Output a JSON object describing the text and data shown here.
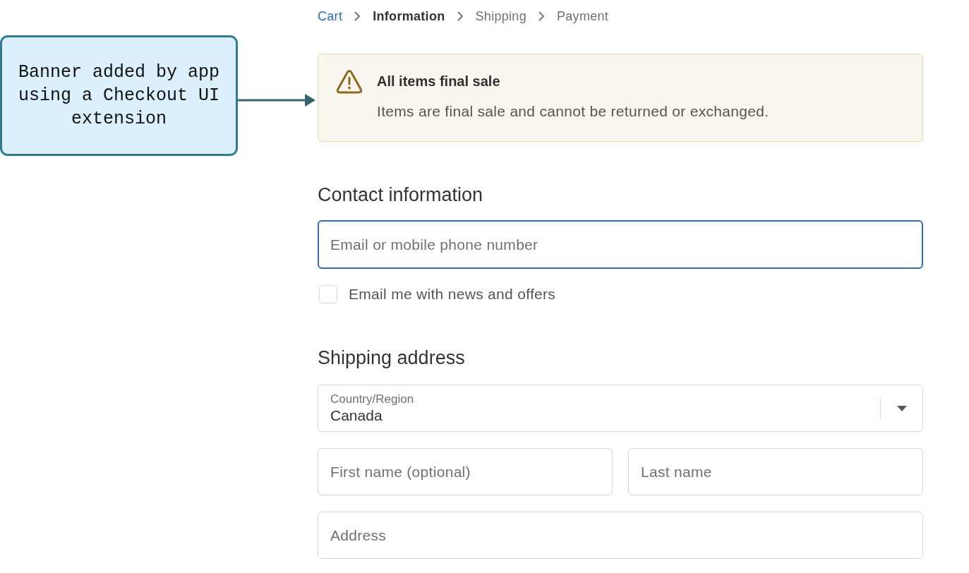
{
  "annotation": {
    "text": "Banner added by app using a Checkout UI extension"
  },
  "breadcrumbs": [
    {
      "label": "Cart",
      "kind": "link"
    },
    {
      "label": "Information",
      "kind": "current"
    },
    {
      "label": "Shipping",
      "kind": "upcoming"
    },
    {
      "label": "Payment",
      "kind": "upcoming"
    }
  ],
  "banner": {
    "kind": "warning",
    "title": "All items final sale",
    "message": "Items are final sale and cannot be returned or exchanged."
  },
  "contact": {
    "heading": "Contact information",
    "email_field": {
      "placeholder": "Email or mobile phone number",
      "focused": true
    },
    "newsletter": {
      "label": "Email me with news and offers",
      "checked": false
    }
  },
  "shipping": {
    "heading": "Shipping address",
    "rows": [
      [
        {
          "kind": "select",
          "label": "Country/Region",
          "value": "Canada"
        }
      ],
      [
        {
          "kind": "text",
          "placeholder": "First name (optional)"
        },
        {
          "kind": "text",
          "placeholder": "Last name"
        }
      ],
      [
        {
          "kind": "text",
          "placeholder": "Address"
        }
      ]
    ]
  }
}
